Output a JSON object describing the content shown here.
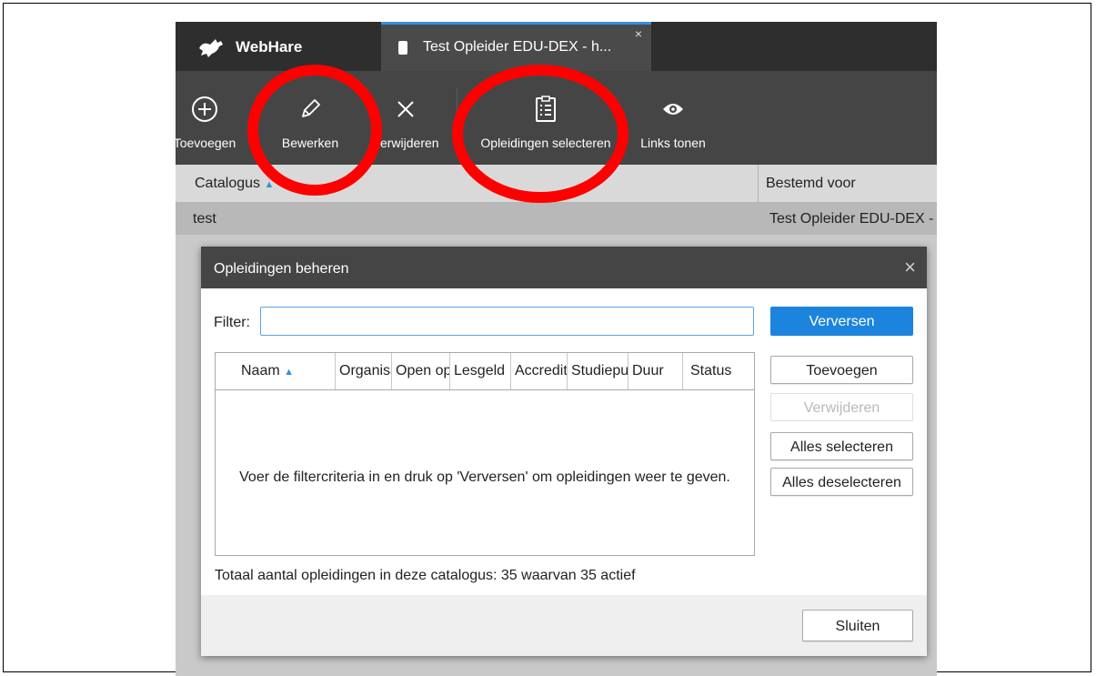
{
  "brand": {
    "name": "WebHare",
    "logo_icon": "webhare-logo-icon"
  },
  "tab": {
    "title": "Test Opleider EDU-DEX - h...",
    "close": "×"
  },
  "toolbar": {
    "add_label": "Toevoegen",
    "edit_label": "Bewerken",
    "delete_label": "Verwijderen",
    "select_label": "Opleidingen selecteren",
    "links_label": "Links tonen"
  },
  "list": {
    "columns": [
      "Catalogus",
      "Bestemd voor"
    ],
    "sort_indicator": "▲",
    "rows": [
      {
        "catalogus": "test",
        "bestemd_voor": "Test Opleider EDU-DEX - h"
      }
    ]
  },
  "dialog": {
    "title": "Opleidingen beheren",
    "close": "×",
    "filter_label": "Filter:",
    "filter_value": "",
    "buttons": {
      "refresh": "Verversen",
      "add": "Toevoegen",
      "delete": "Verwijderen",
      "select_all": "Alles selecteren",
      "deselect_all": "Alles deselecteren",
      "close": "Sluiten"
    },
    "grid_columns": [
      "Naam",
      "Organisatie",
      "Open op",
      "Lesgeld",
      "Accreditatie",
      "Studiepunten",
      "Duur",
      "Status"
    ],
    "sort_indicator": "▲",
    "empty_message": "Voer de filtercriteria in en druk op 'Verversen' om opleidingen weer te geven.",
    "totals": "Totaal aantal opleidingen in deze catalogus: 35 waarvan 35 actief"
  },
  "annotations": {
    "color": "#ff0000",
    "count": 2
  }
}
